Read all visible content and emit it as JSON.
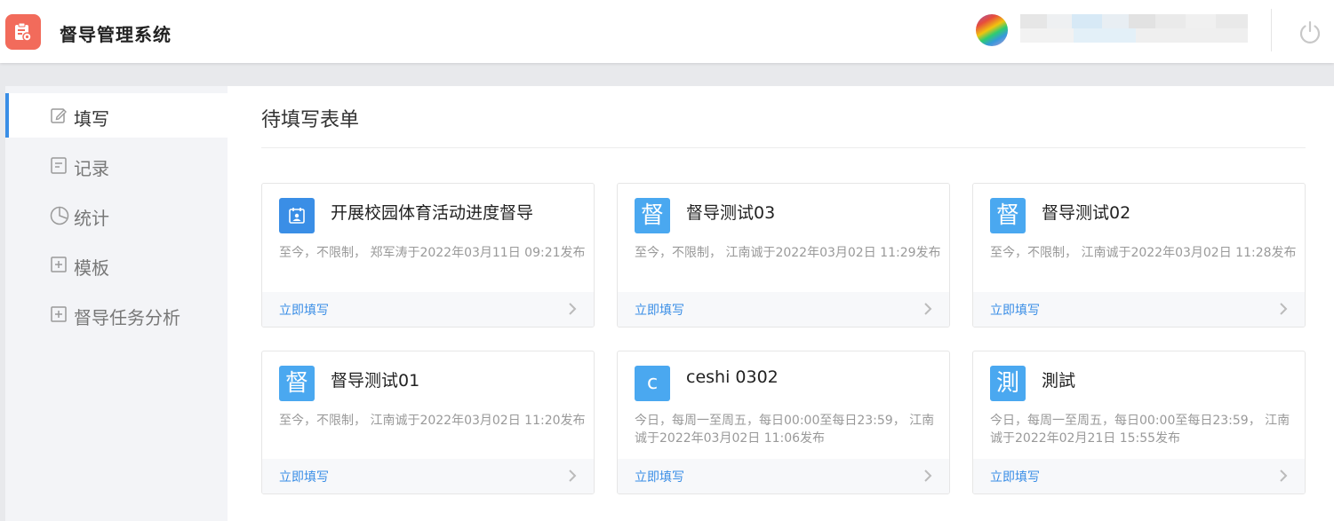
{
  "header": {
    "app_title": "督导管理系统",
    "logo_icon": "clipboard-icon",
    "power_icon": "power-icon",
    "brand_color": "#f26b5b"
  },
  "sidebar": {
    "items": [
      {
        "label": "填写",
        "icon": "edit-icon",
        "active": true
      },
      {
        "label": "记录",
        "icon": "receipt-icon",
        "active": false
      },
      {
        "label": "统计",
        "icon": "pie-chart-icon",
        "active": false
      },
      {
        "label": "模板",
        "icon": "plus-square-icon",
        "active": false
      },
      {
        "label": "督导任务分析",
        "icon": "plus-square-icon",
        "active": false
      }
    ]
  },
  "main": {
    "title": "待填写表单",
    "accent_color": "#3a8ee6",
    "cards": [
      {
        "icon_char": "",
        "icon": "calendar-user-icon",
        "title": "开展校园体育活动进度督导",
        "desc": "至今，不限制， 郑军涛于2022年03月11日 09:21发布",
        "action": "立即填写"
      },
      {
        "icon_char": "督",
        "title": "督导测试03",
        "desc": "至今，不限制， 江南诚于2022年03月02日 11:29发布",
        "action": "立即填写"
      },
      {
        "icon_char": "督",
        "title": "督导测试02",
        "desc": "至今，不限制， 江南诚于2022年03月02日 11:28发布",
        "action": "立即填写"
      },
      {
        "icon_char": "督",
        "title": "督导测试01",
        "desc": "至今，不限制， 江南诚于2022年03月02日 11:20发布",
        "action": "立即填写"
      },
      {
        "icon_char": "c",
        "title": "ceshi 0302",
        "desc": "今日，每周一至周五，每日00:00至每日23:59， 江南诚于2022年03月02日 11:06发布",
        "action": "立即填写"
      },
      {
        "icon_char": "測",
        "title": "測試",
        "desc": "今日，每周一至周五，每日00:00至每日23:59， 江南诚于2022年02月21日 15:55发布",
        "action": "立即填写"
      }
    ]
  }
}
